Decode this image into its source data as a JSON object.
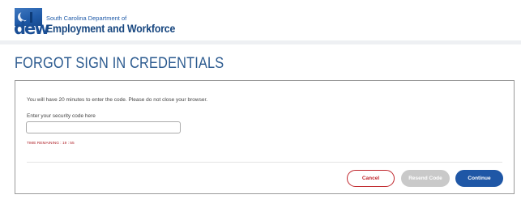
{
  "header": {
    "org_line": "South Carolina Department of",
    "org_name": "Employment and Workforce",
    "logo_letters": "dew"
  },
  "page": {
    "title": "FORGOT SIGN IN CREDENTIALS"
  },
  "card": {
    "instruction": "You will have 20 minutes to enter the code. Please do not close your browser.",
    "field_label": "Enter your security code here",
    "field_value": "",
    "timer": "TIME REMAINING : 19 : 55"
  },
  "buttons": {
    "cancel": "Cancel",
    "resend": "Resend Code",
    "continue": "Continue"
  },
  "colors": {
    "brand_blue": "#1f57a6",
    "cancel_red": "#c0272d",
    "disabled_gray": "#c9c9c9"
  }
}
